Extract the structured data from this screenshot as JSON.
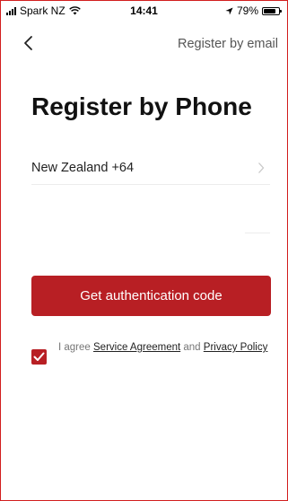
{
  "status_bar": {
    "carrier": "Spark NZ",
    "time": "14:41",
    "battery_percent": "79%",
    "battery_level": 0.79,
    "icons": [
      "signal-bars-icon",
      "wifi-icon",
      "location-arrow-icon",
      "battery-icon"
    ]
  },
  "nav": {
    "back_icon": "chevron-left-icon",
    "register_email_label": "Register by email"
  },
  "page": {
    "title": "Register by Phone"
  },
  "form": {
    "country_label": "New Zealand +64",
    "country_chevron_icon": "chevron-right-icon",
    "phone_value": "",
    "phone_placeholder": ""
  },
  "actions": {
    "get_code_label": "Get authentication code"
  },
  "agreement": {
    "checked": true,
    "prefix": "I agree",
    "service_link": "Service Agreement",
    "conjunction": "and",
    "privacy_link": "Privacy Policy"
  },
  "colors": {
    "accent": "#b81f24",
    "border": "#d21f1f"
  }
}
